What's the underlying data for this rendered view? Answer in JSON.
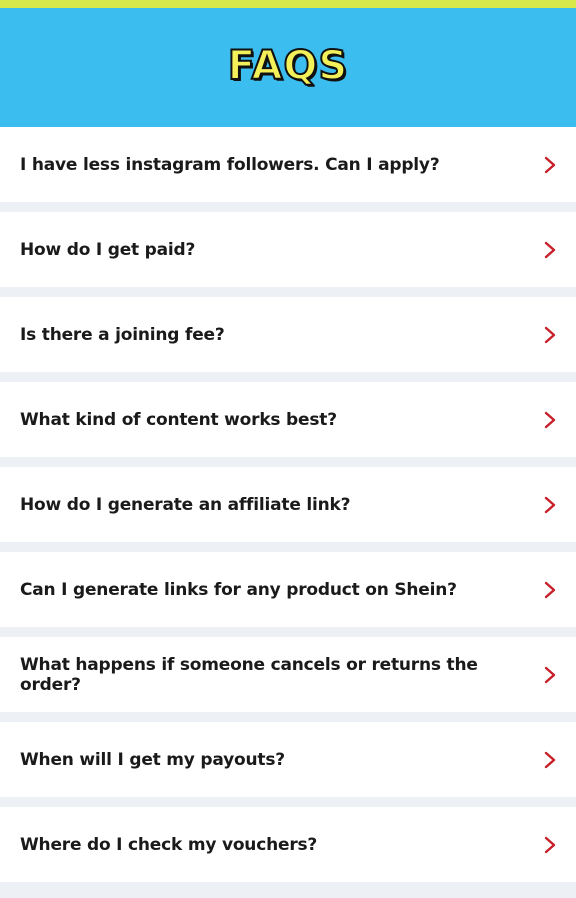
{
  "header": {
    "title": "FAQS"
  },
  "colors": {
    "top_strip": "#d8e84a",
    "header_bg": "#3cbdf0",
    "title_fill": "#f3f05a",
    "chevron": "#c8202a"
  },
  "faqs": [
    {
      "question": "I have less instagram followers. Can I apply?",
      "icon": "chevron-right-icon"
    },
    {
      "question": "How do I get paid?",
      "icon": "chevron-right-icon"
    },
    {
      "question": "Is there a joining fee?",
      "icon": "chevron-right-icon"
    },
    {
      "question": "What kind of content works best?",
      "icon": "chevron-right-icon"
    },
    {
      "question": "How do I generate an affiliate link?",
      "icon": "chevron-right-icon"
    },
    {
      "question": "Can I generate links for any product on Shein?",
      "icon": "chevron-right-icon"
    },
    {
      "question": "What happens if someone cancels or returns the order?",
      "icon": "chevron-right-icon"
    },
    {
      "question": "When will I get my payouts?",
      "icon": "chevron-right-icon"
    },
    {
      "question": "Where do I check my vouchers?",
      "icon": "chevron-right-icon"
    }
  ]
}
